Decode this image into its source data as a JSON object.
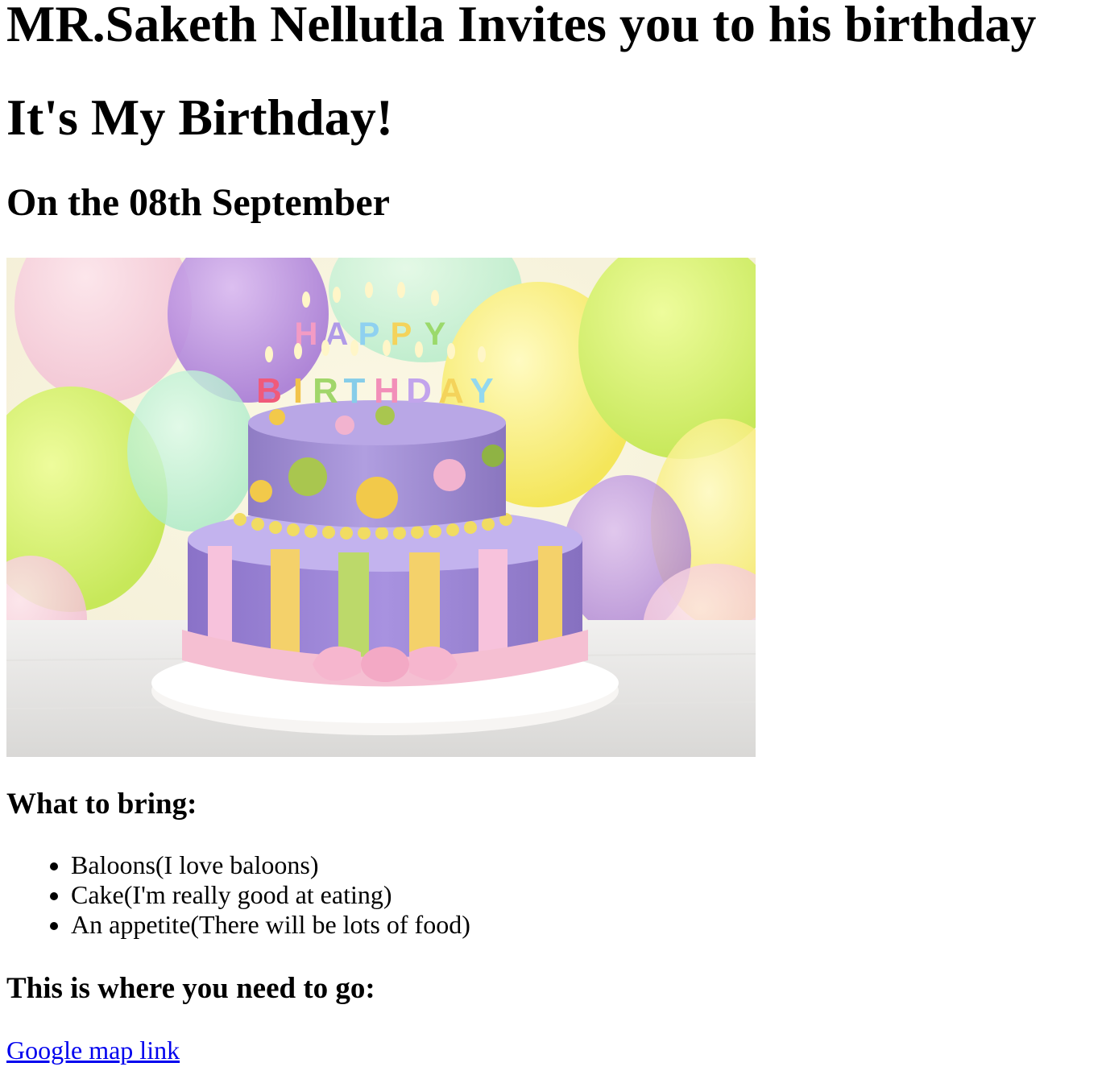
{
  "header": {
    "invite_title": "MR.Saketh Nellutla Invites you to his birthday",
    "birthday_heading": "It's My Birthday!",
    "date_heading": "On the 08th September"
  },
  "image": {
    "name": "birthday-cake-photo",
    "candle_text": "HAPPY BIRTHDAY"
  },
  "bring": {
    "heading": "What to bring:",
    "items": [
      "Baloons(I love baloons)",
      "Cake(I'm really good at eating)",
      "An appetite(There will be lots of food)"
    ]
  },
  "location": {
    "heading": "This is where you need to go:",
    "link_text": "Google map link"
  },
  "colors": {
    "text": "#000000",
    "link": "#0000ee",
    "background": "#ffffff"
  }
}
